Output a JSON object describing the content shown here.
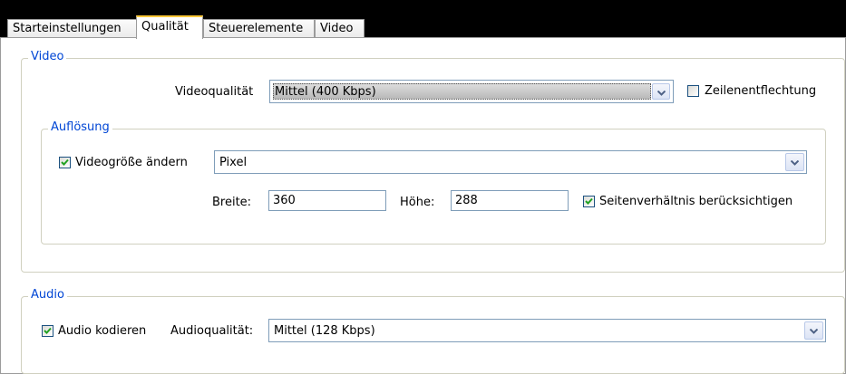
{
  "tabs": [
    {
      "label": "Starteinstellungen",
      "active": false
    },
    {
      "label": "Qualität",
      "active": true
    },
    {
      "label": "Steuerelemente",
      "active": false
    },
    {
      "label": "Video",
      "active": false
    }
  ],
  "video": {
    "legend": "Video",
    "quality_label": "Videoqualität",
    "quality_value": "Mittel (400 Kbps)",
    "deinterlace_label": "Zeilenentflechtung",
    "deinterlace_checked": false,
    "resolution": {
      "legend": "Auflösung",
      "resize_label": "Videogröße ändern",
      "resize_checked": true,
      "unit_value": "Pixel",
      "width_label": "Breite:",
      "width_value": "360",
      "height_label": "Höhe:",
      "height_value": "288",
      "aspect_label": "Seitenverhältnis berücksichtigen",
      "aspect_checked": true
    }
  },
  "audio": {
    "legend": "Audio",
    "encode_label": "Audio kodieren",
    "encode_checked": true,
    "quality_label": "Audioqualität:",
    "quality_value": "Mittel (128 Kbps)"
  },
  "colors": {
    "legend": "#0046d5",
    "tab_highlight": "#ffc839",
    "border": "#7f9db9"
  }
}
